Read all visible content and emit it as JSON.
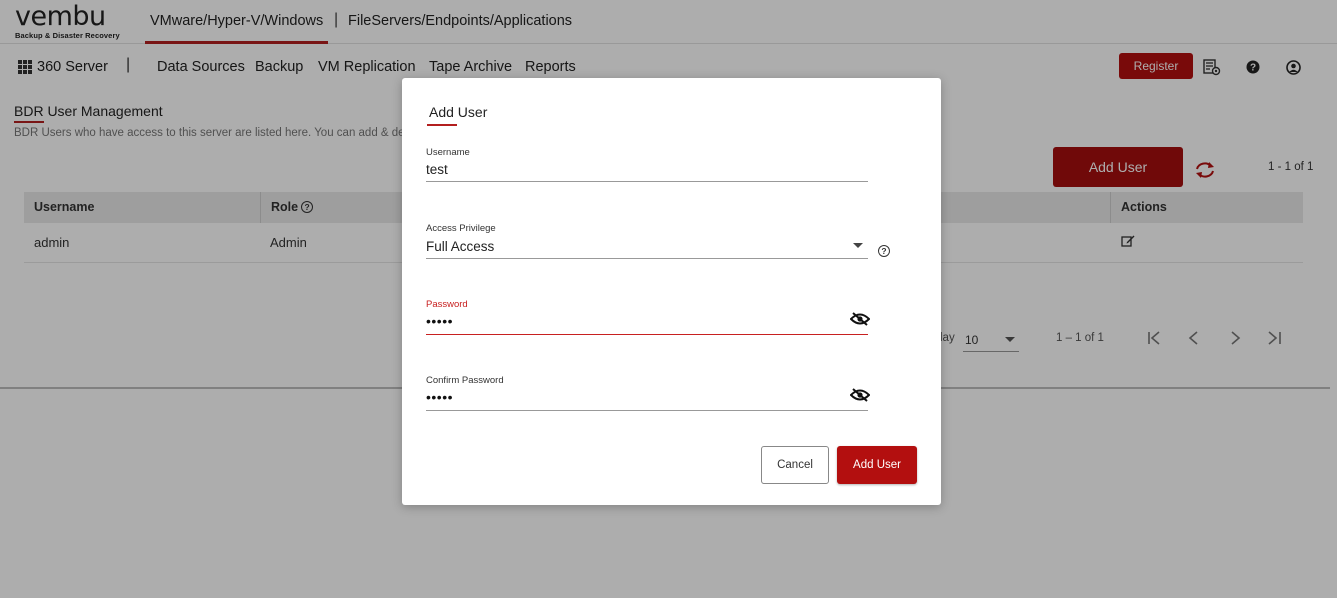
{
  "header": {
    "logo_text": "vembu",
    "logo_subtitle": "Backup & Disaster Recovery",
    "tabs": [
      {
        "label": "VMware/Hyper-V/Windows",
        "active": true
      },
      {
        "label": "FileServers/Endpoints/Applications",
        "active": false
      }
    ],
    "separator": "|"
  },
  "nav": {
    "apps_label": "360 Server",
    "separator": "|",
    "items": [
      "Data Sources",
      "Backup",
      "VM Replication",
      "Tape Archive",
      "Reports"
    ],
    "register_label": "Register"
  },
  "page": {
    "title": "BDR User Management",
    "description": "BDR Users who have access to this server are listed here. You can add & de",
    "add_user_label": "Add User",
    "count": "1 - 1 of 1",
    "table": {
      "columns": [
        "Username",
        "Role",
        "Actions"
      ],
      "rows": [
        {
          "username": "admin",
          "role": "Admin"
        }
      ]
    },
    "pager": {
      "display_label": "lay",
      "page_size": "10",
      "range": "1 – 1 of 1"
    }
  },
  "modal": {
    "title": "Add User",
    "username_label": "Username",
    "username_value": "test",
    "privilege_label": "Access Privilege",
    "privilege_value": "Full Access",
    "password_label": "Password",
    "password_value": "•••••",
    "confirm_label": "Confirm Password",
    "confirm_value": "•••••",
    "cancel_label": "Cancel",
    "submit_label": "Add User"
  },
  "colors": {
    "brand_red": "#b30f0f",
    "error_red": "#c82020"
  }
}
